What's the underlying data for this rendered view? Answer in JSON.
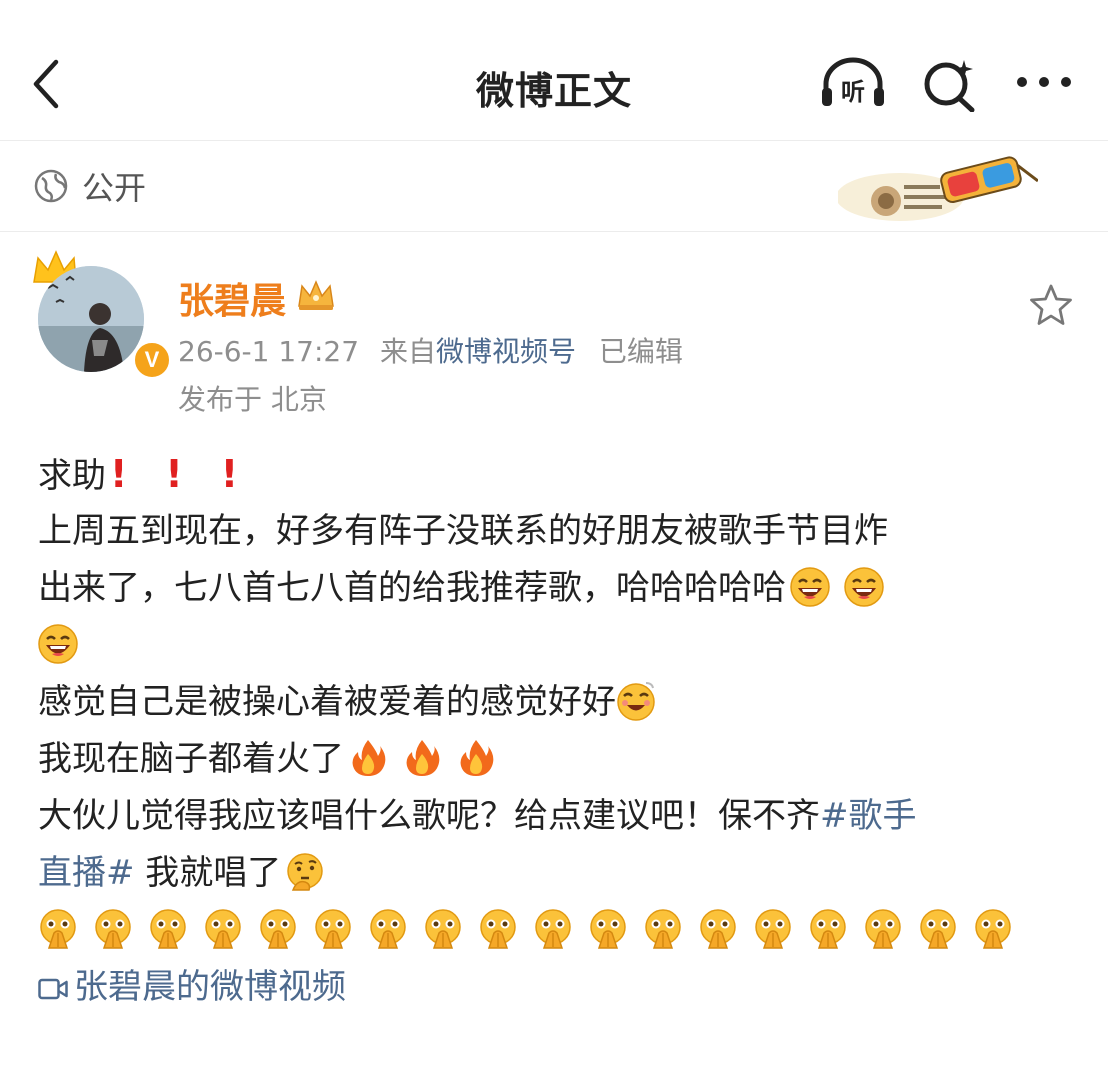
{
  "header": {
    "title": "微博正文",
    "listen_label": "听"
  },
  "privacy": {
    "label": "公开"
  },
  "post": {
    "author": "张碧晨",
    "timestamp": "26-6-1 17:27",
    "source_prefix": "来自",
    "source": "微博视频号",
    "edited": "已编辑",
    "location": "发布于 北京",
    "lines": {
      "l1": "求助",
      "l2": "上周五到现在，好多有阵子没联系的好朋友被歌手节目炸",
      "l3": "出来了，七八首七八首的给我推荐歌，哈哈哈哈哈",
      "l5": "感觉自己是被操心着被爱着的感觉好好",
      "l6": "我现在脑子都着火了",
      "l7_text": "大伙儿觉得我应该唱什么歌呢？给点建议吧！保不齐",
      "l7_tag": "#歌手",
      "l8_tag": "直播#",
      "l8_text": " 我就唱了"
    },
    "video_link": "张碧晨的微博视频"
  },
  "colors": {
    "username": "#ee7e1c",
    "link": "#4d6a8e",
    "meta": "#8e8e8e",
    "alert": "#e02020"
  }
}
